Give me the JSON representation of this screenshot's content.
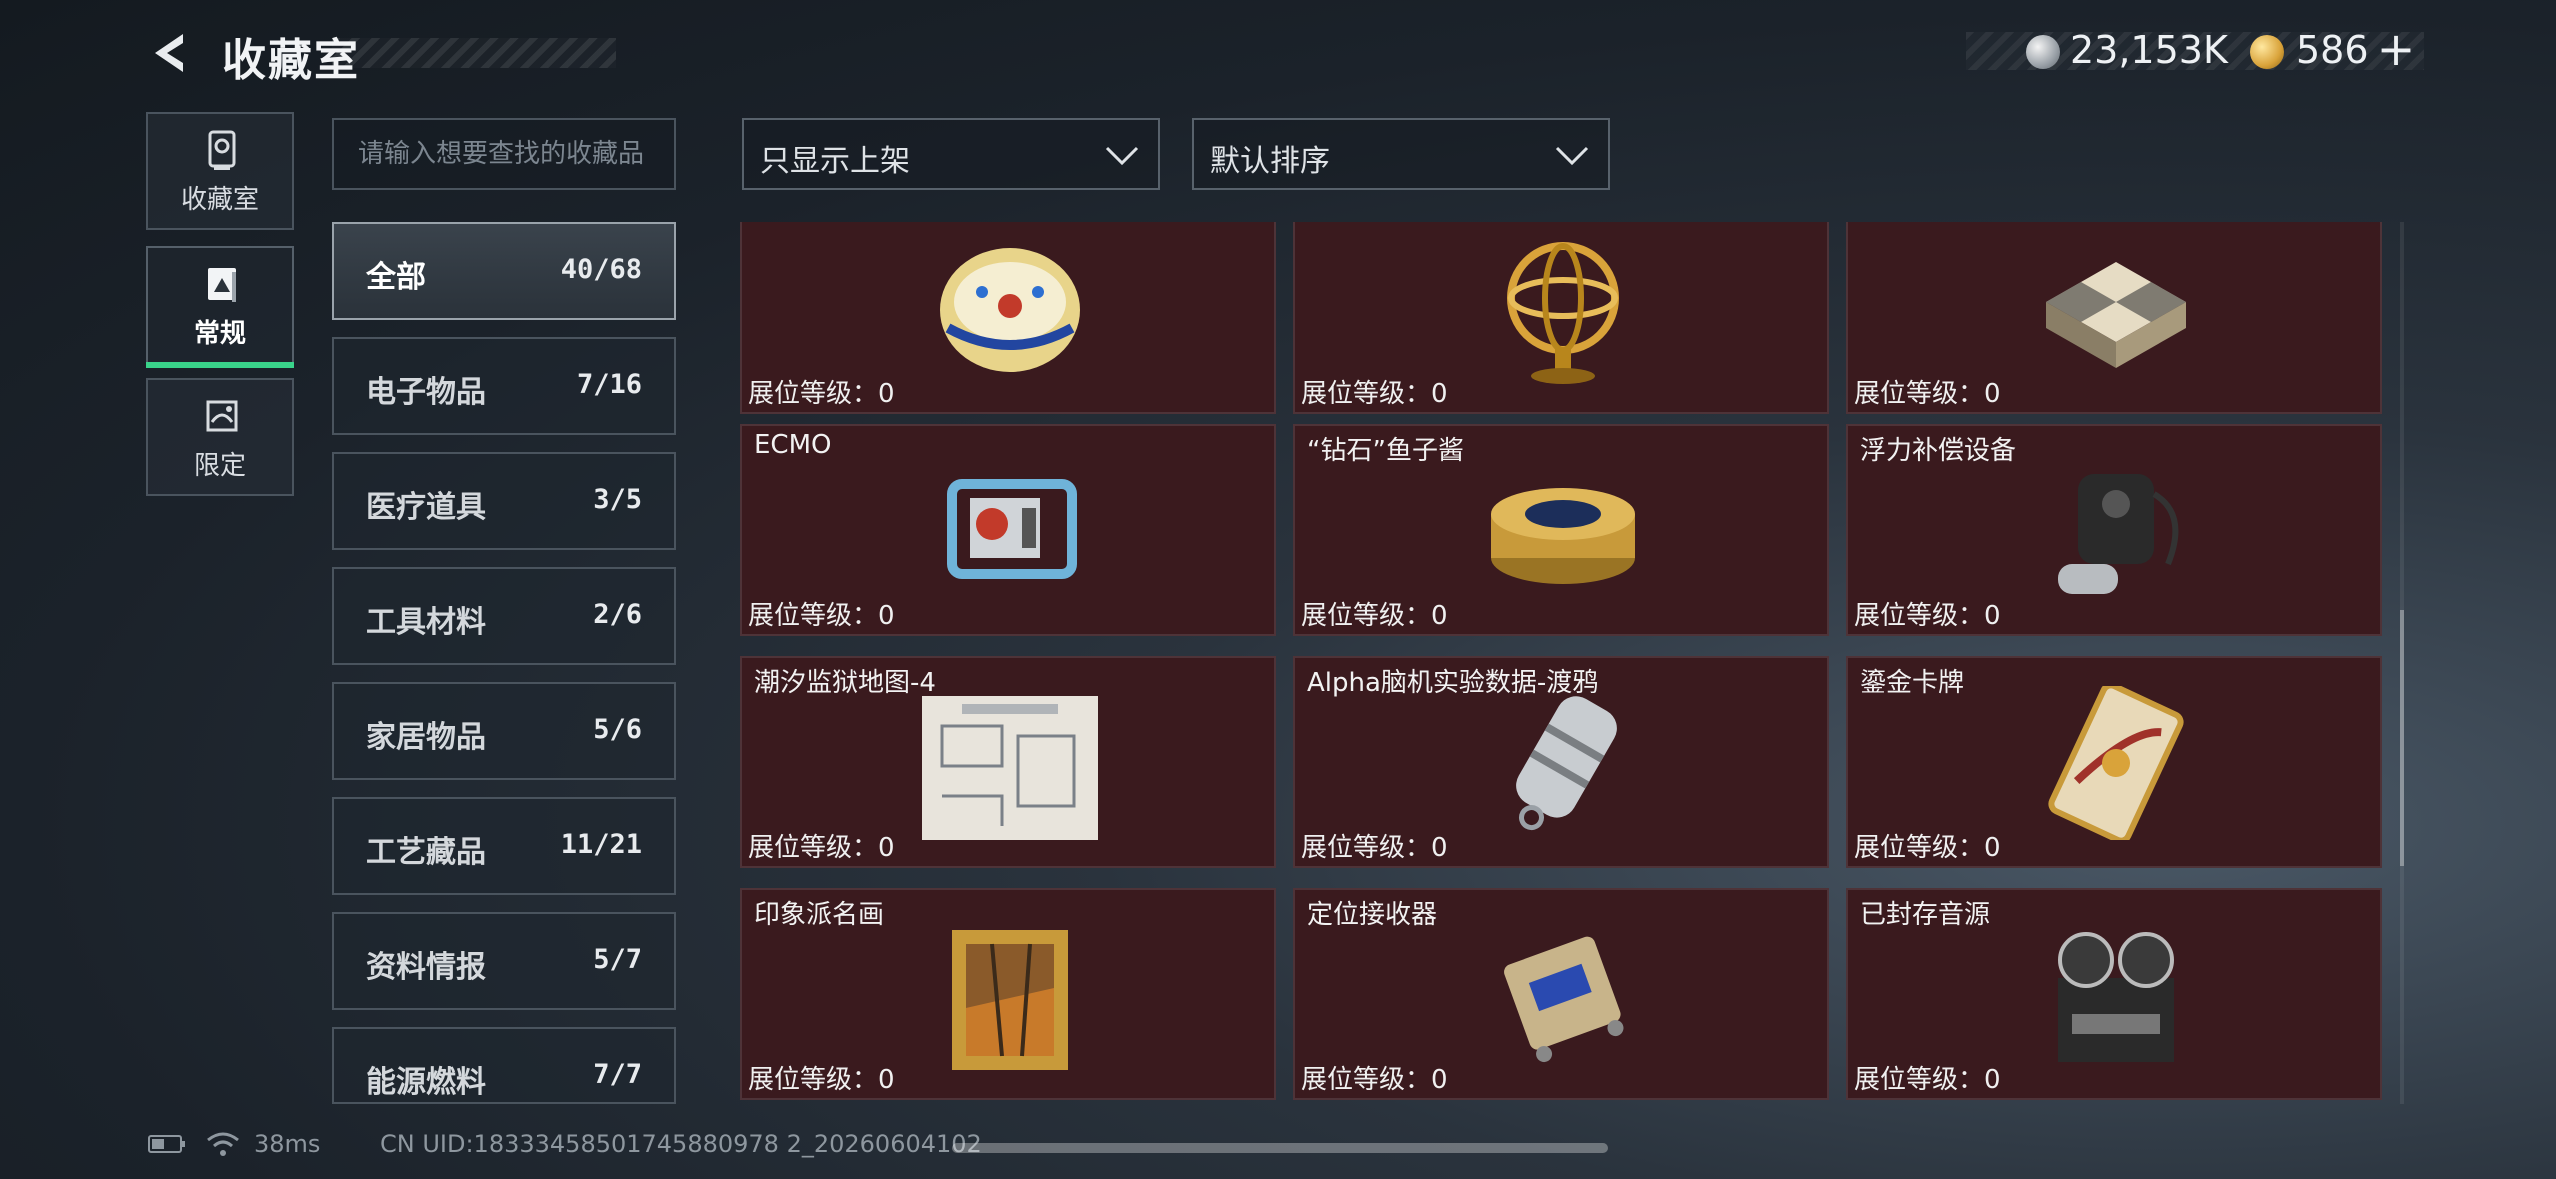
{
  "header": {
    "title": "收藏室",
    "currency_silver": "23,153K",
    "currency_gold": "586",
    "plus_label": "+"
  },
  "side_tabs": [
    {
      "label": "收藏室",
      "icon": "trophy-icon",
      "active": false
    },
    {
      "label": "常规",
      "icon": "album-icon",
      "active": true
    },
    {
      "label": "限定",
      "icon": "limited-icon",
      "active": false
    }
  ],
  "search": {
    "placeholder": "请输入想要查找的收藏品"
  },
  "filters": {
    "display": "只显示上架",
    "sort": "默认排序"
  },
  "categories": [
    {
      "name": "全部",
      "count": "40/68",
      "active": true
    },
    {
      "name": "电子物品",
      "count": "7/16"
    },
    {
      "name": "医疗道具",
      "count": "3/5"
    },
    {
      "name": "工具材料",
      "count": "2/6"
    },
    {
      "name": "家居物品",
      "count": "5/6"
    },
    {
      "name": "工艺藏品",
      "count": "11/21"
    },
    {
      "name": "资料情报",
      "count": "5/7"
    },
    {
      "name": "能源燃料",
      "count": "7/7"
    }
  ],
  "level_label": "展位等级：0",
  "items": [
    {
      "name": "",
      "icon": "jeweled-egg-icon"
    },
    {
      "name": "",
      "icon": "armillary-sphere-icon"
    },
    {
      "name": "",
      "icon": "chess-box-icon"
    },
    {
      "name": "ECMO",
      "icon": "ecmo-machine-icon"
    },
    {
      "name": "“钻石”鱼子酱",
      "icon": "caviar-tin-icon"
    },
    {
      "name": "浮力补偿设备",
      "icon": "buoyancy-device-icon"
    },
    {
      "name": "潮汐监狱地图-4",
      "icon": "prison-map-icon"
    },
    {
      "name": "Alpha脑机实验数据-渡鸦",
      "icon": "data-capsule-icon"
    },
    {
      "name": "鎏金卡牌",
      "icon": "gilded-card-icon"
    },
    {
      "name": "印象派名画",
      "icon": "framed-painting-icon"
    },
    {
      "name": "定位接收器",
      "icon": "locator-receiver-icon"
    },
    {
      "name": "已封存音源",
      "icon": "reel-recorder-icon"
    }
  ],
  "footer": {
    "ping": "38ms",
    "uid": "CN UID:18333458501745880978 2_20260604102"
  },
  "colors": {
    "card_bg": "#3a1a1e",
    "active_green": "#39d38a"
  }
}
